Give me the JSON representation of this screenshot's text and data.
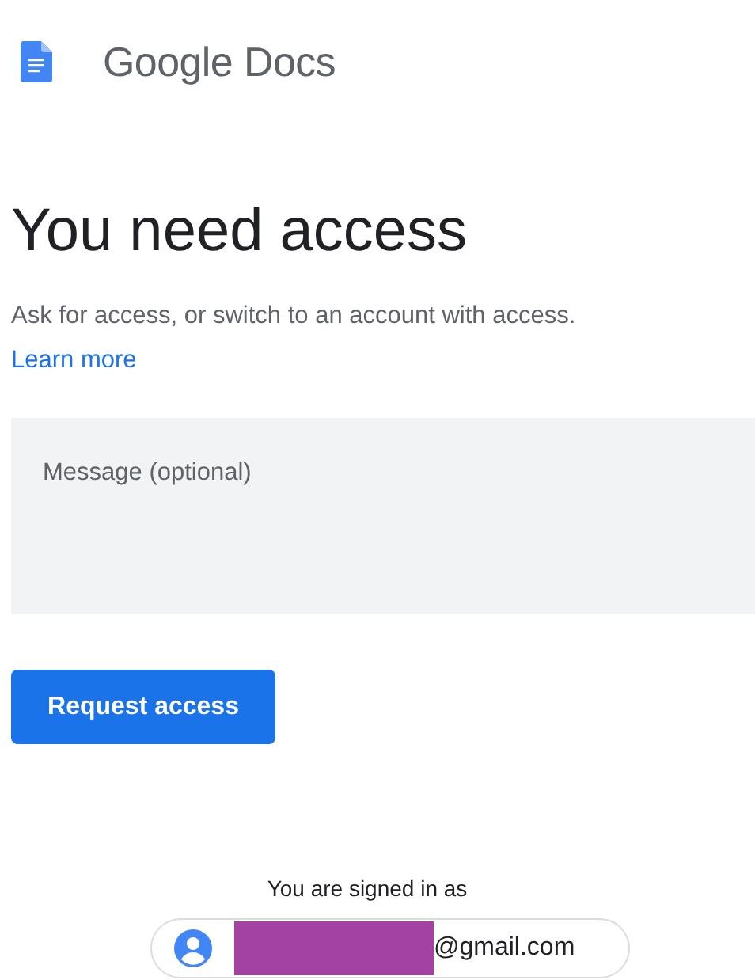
{
  "header": {
    "product": "Google Docs"
  },
  "title": "You need access",
  "description": "Ask for access, or switch to an account with access.",
  "learn_more": "Learn more",
  "message": {
    "placeholder": "Message (optional)"
  },
  "request_button": "Request access",
  "signed_in_label": "You are signed in as",
  "account": {
    "email": "@gmail.com"
  }
}
